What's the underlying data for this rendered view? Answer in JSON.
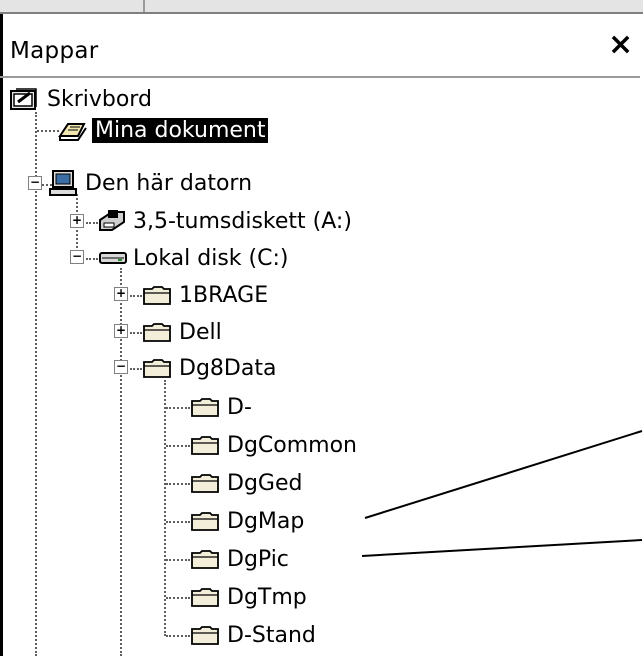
{
  "pane": {
    "title": "Mappar",
    "close": "×"
  },
  "tree": {
    "desktop": "Skrivbord",
    "my_documents": "Mina dokument",
    "my_computer": "Den här datorn",
    "floppy": "3,5-tumsdiskett (A:)",
    "local_disk": "Lokal disk (C:)",
    "folders": {
      "brage": "1BRAGE",
      "dell": "Dell",
      "dg8data": "Dg8Data",
      "d_minus": "D-",
      "dgcommon": "DgCommon",
      "dgged": "DgGed",
      "dgmap": "DgMap",
      "dgpic": "DgPic",
      "dgtmp": "DgTmp",
      "d_stand": "D-Stand"
    }
  }
}
